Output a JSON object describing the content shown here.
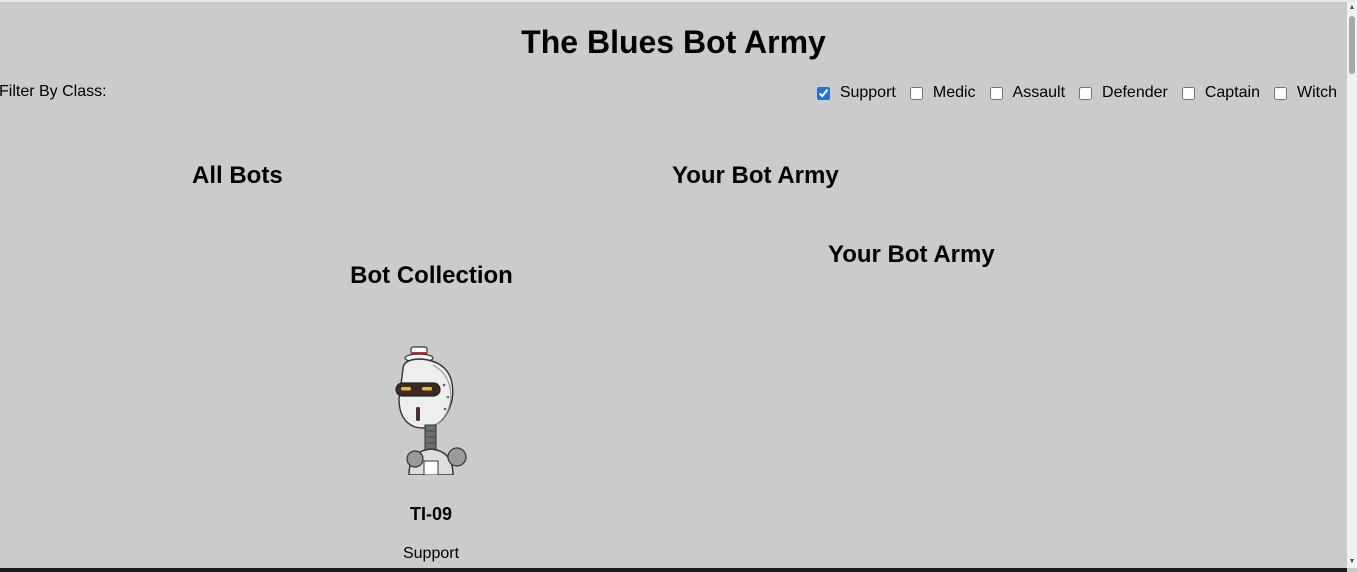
{
  "page": {
    "title": "The Blues Bot Army"
  },
  "filter": {
    "label": "Filter By Class:",
    "options": [
      {
        "label": "Support",
        "checked": true
      },
      {
        "label": "Medic",
        "checked": false
      },
      {
        "label": "Assault",
        "checked": false
      },
      {
        "label": "Defender",
        "checked": false
      },
      {
        "label": "Captain",
        "checked": false
      },
      {
        "label": "Witch",
        "checked": false
      }
    ]
  },
  "sections": {
    "all_bots": "All Bots",
    "your_army_header": "Your Bot Army",
    "bot_collection": "Bot Collection",
    "your_army_panel": "Your Bot Army"
  },
  "bots": [
    {
      "name": "TI-09",
      "bot_class": "Support",
      "avatar": "robot-avatar-icon"
    }
  ],
  "colors": {
    "background": "#cbcbcb",
    "checkbox_accent": "#1a73e8"
  }
}
